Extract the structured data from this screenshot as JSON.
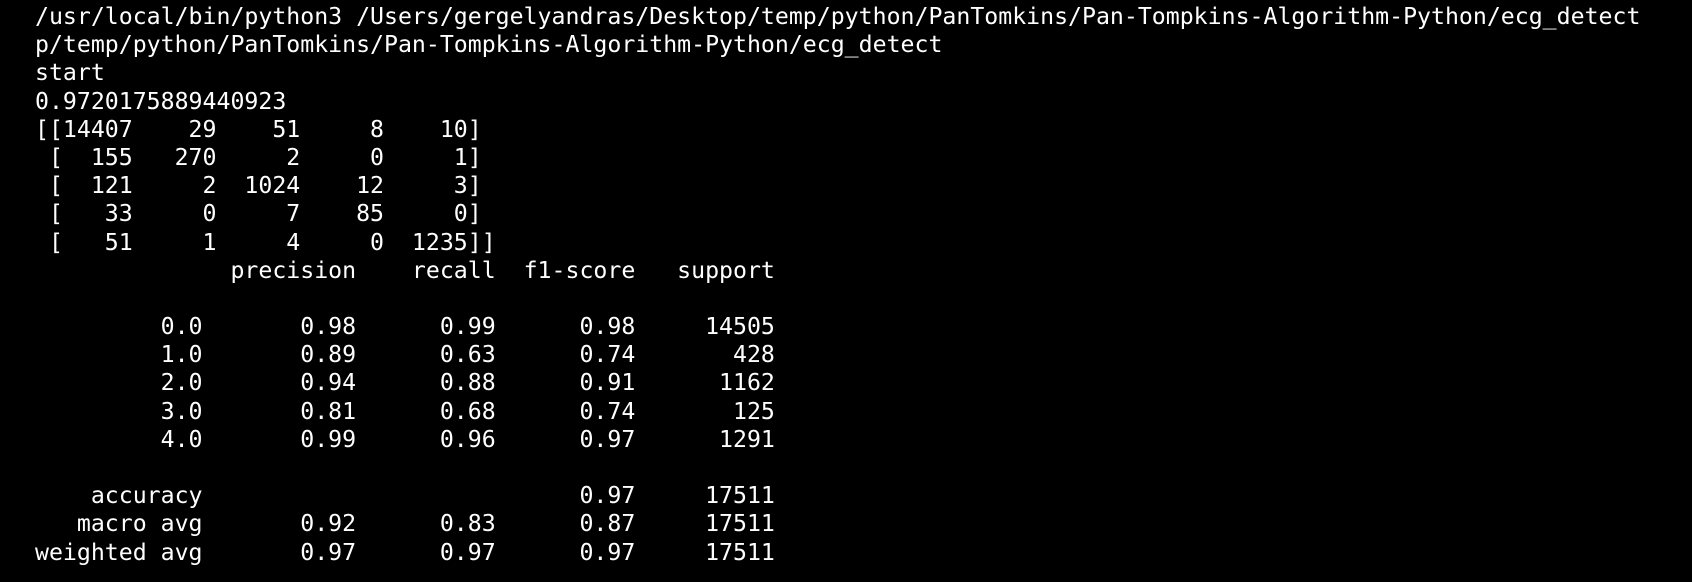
{
  "terminal": {
    "background_color": "#000000",
    "text_color": "#ffffff",
    "lines": [
      "/usr/local/bin/python3 /Users/gergelyandras/Desktop/temp/python/PanTomkins/Pan-Tompkins-Algorithm-Python/ecg_detect",
      "p/temp/python/PanTomkins/Pan-Tompkins-Algorithm-Python/ecg_detect",
      "start",
      "0.9720175889440923",
      "[[14407    29    51     8    10]",
      " [  155   270     2     0     1]",
      " [  121     2  1024    12     3]",
      " [   33     0     7    85     0]",
      " [   51     1     4     0  1235]]",
      "              precision    recall  f1-score   support",
      "",
      "         0.0       0.98      0.99      0.98     14505",
      "         1.0       0.89      0.63      0.74       428",
      "         2.0       0.94      0.88      0.91      1162",
      "         3.0       0.81      0.68      0.74       125",
      "         4.0       0.99      0.96      0.97      1291",
      "",
      "    accuracy                           0.97     17511",
      "   macro avg       0.92      0.83      0.87     17511",
      "weighted avg       0.97      0.97      0.97     17511"
    ]
  }
}
